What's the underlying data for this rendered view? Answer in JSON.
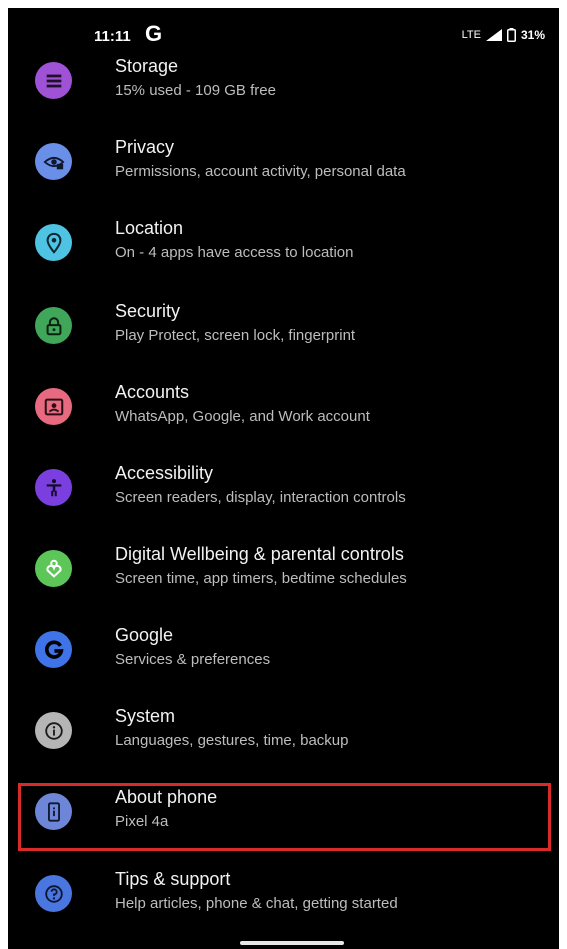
{
  "status_bar": {
    "time": "11:11",
    "app_indicator": "G",
    "network": "LTE",
    "battery": "31%"
  },
  "settings": [
    {
      "title": "Storage",
      "subtitle": "15% used - 109 GB free",
      "icon": "storage-icon",
      "color": "#a052d6"
    },
    {
      "title": "Privacy",
      "subtitle": "Permissions, account activity, personal data",
      "icon": "privacy-eye-icon",
      "color": "#6a8fe8"
    },
    {
      "title": "Location",
      "subtitle": "On - 4 apps have access to location",
      "icon": "location-pin-icon",
      "color": "#4ec3e4"
    },
    {
      "title": "Security",
      "subtitle": "Play Protect, screen lock, fingerprint",
      "icon": "lock-icon",
      "color": "#3fa65a"
    },
    {
      "title": "Accounts",
      "subtitle": "WhatsApp, Google, and Work account",
      "icon": "account-box-icon",
      "color": "#e86a80"
    },
    {
      "title": "Accessibility",
      "subtitle": "Screen readers, display, interaction controls",
      "icon": "accessibility-icon",
      "color": "#7b3fe0"
    },
    {
      "title": "Digital Wellbeing & parental controls",
      "subtitle": "Screen time, app timers, bedtime schedules",
      "icon": "wellbeing-heart-icon",
      "color": "#5cc659"
    },
    {
      "title": "Google",
      "subtitle": "Services & preferences",
      "icon": "google-g-icon",
      "color": "#3f73e8"
    },
    {
      "title": "System",
      "subtitle": "Languages, gestures, time, backup",
      "icon": "info-icon",
      "color": "#b5b5b5"
    },
    {
      "title": "About phone",
      "subtitle": "Pixel 4a",
      "icon": "phone-info-icon",
      "color": "#6d86d8"
    },
    {
      "title": "Tips & support",
      "subtitle": "Help articles, phone & chat, getting started",
      "icon": "help-icon",
      "color": "#4a76e0"
    }
  ],
  "highlight": {
    "row": "About phone",
    "color": "#d92a2a"
  }
}
